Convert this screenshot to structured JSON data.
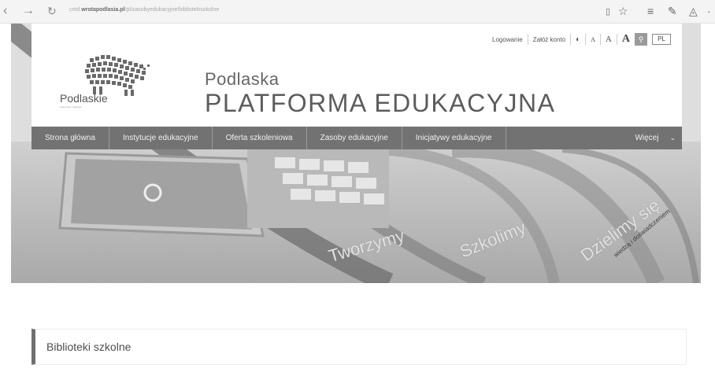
{
  "browser": {
    "url_prefix": "cntd.",
    "url_host": "wrotapodlasia.pl",
    "url_path": "/pl/zasobyedukacyjne/bibliotekiszkolne"
  },
  "top_links": {
    "login": "Logowanie",
    "register": "Załóż konto",
    "contrast_icon": "contrast-icon",
    "font_small": "A",
    "font_medium": "A",
    "font_large": "A",
    "search_icon": "search-icon",
    "language": "PL"
  },
  "logo": {
    "text": "Podlaskie",
    "subtext": "Fascynuje i Inspiruje"
  },
  "site_title": {
    "line1": "Podlaska",
    "line2": "PLATFORMA EDUKACYJNA"
  },
  "main_nav": {
    "items": [
      {
        "label": "Strona główna"
      },
      {
        "label": "Instytucje edukacyjne"
      },
      {
        "label": "Oferta szkoleniowa"
      },
      {
        "label": "Zasoby edukacyjne"
      },
      {
        "label": "Inicjatywy edukacyjne"
      }
    ],
    "more_label": "Więcej",
    "more_icon": "chevron-down-icon"
  },
  "hero": {
    "word1": "Tworzymy",
    "word2": "Szkolimy",
    "word3": "Dzielimy się",
    "tagline": "wiedzą i doświadczeniem"
  },
  "section": {
    "title": "Biblioteki szkolne"
  },
  "colors": {
    "nav_bg": "#727272",
    "accent_border": "#6f6f6f",
    "page_bg": "#ffffff"
  }
}
